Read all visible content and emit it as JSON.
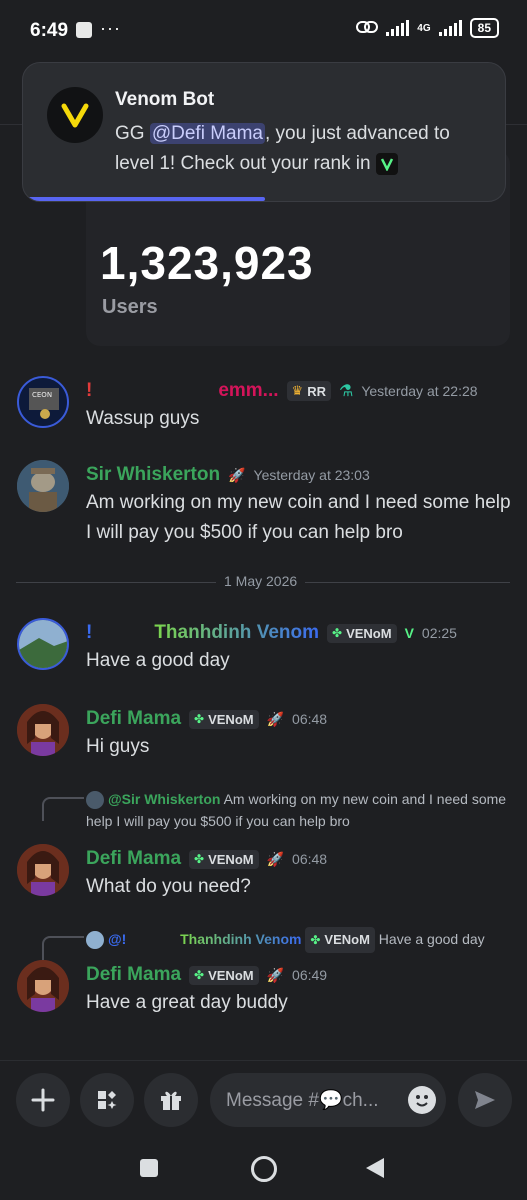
{
  "status_bar": {
    "time": "6:49",
    "dots": "···",
    "network": "4G",
    "battery": "85"
  },
  "stats": {
    "number": "1,323,923",
    "label": "Users"
  },
  "toast": {
    "title": "Venom Bot",
    "text_before": "GG ",
    "mention": "@Defi Mama",
    "text_after": ", you just advanced to level 1! Check out your rank in "
  },
  "messages": [
    {
      "name_prefix": "!",
      "name": "emm...",
      "badge": "RR",
      "time": "Yesterday at 22:28",
      "text": "Wassup guys",
      "name_color": "#e02a8a"
    },
    {
      "name": "Sir Whiskerton",
      "time": "Yesterday at 23:03",
      "text": "Am working on my new coin and I need some help I will pay you $500  if you can help bro",
      "name_color": "#3ba55c"
    },
    {
      "name_prefix": "!",
      "name": "Thanhdinh Venom",
      "badge": "VENoM",
      "time": "02:25",
      "text": "Have a good day"
    },
    {
      "name": "Defi Mama",
      "badge": "VENoM",
      "time": "06:48",
      "text": "Hi guys",
      "name_color": "#3ba55c"
    },
    {
      "reply_name": "@Sir Whiskerton",
      "reply_text": "Am working on my new coin and I need some help I will pay you $500  if you can help bro",
      "name": "Defi Mama",
      "badge": "VENoM",
      "time": "06:48",
      "text": "What do you need?",
      "name_color": "#3ba55c"
    },
    {
      "reply_name": "@!",
      "reply_name2": "Thanhdinh Venom",
      "reply_badge": "VENoM",
      "reply_text": "Have a good day",
      "name": "Defi Mama",
      "badge": "VENoM",
      "time": "06:49",
      "text": "Have a great day buddy",
      "name_color": "#3ba55c"
    }
  ],
  "divider": {
    "label": "1 May 2026"
  },
  "input": {
    "placeholder": "Message #💬ch..."
  },
  "colors": {
    "accent": "#5865f2",
    "green_name": "#3ba55c",
    "background": "#1e1f22"
  },
  "icons": {
    "add": "plus-icon",
    "apps": "apps-icon",
    "gift": "gift-icon",
    "emoji": "emoji-icon",
    "send": "send-icon"
  }
}
